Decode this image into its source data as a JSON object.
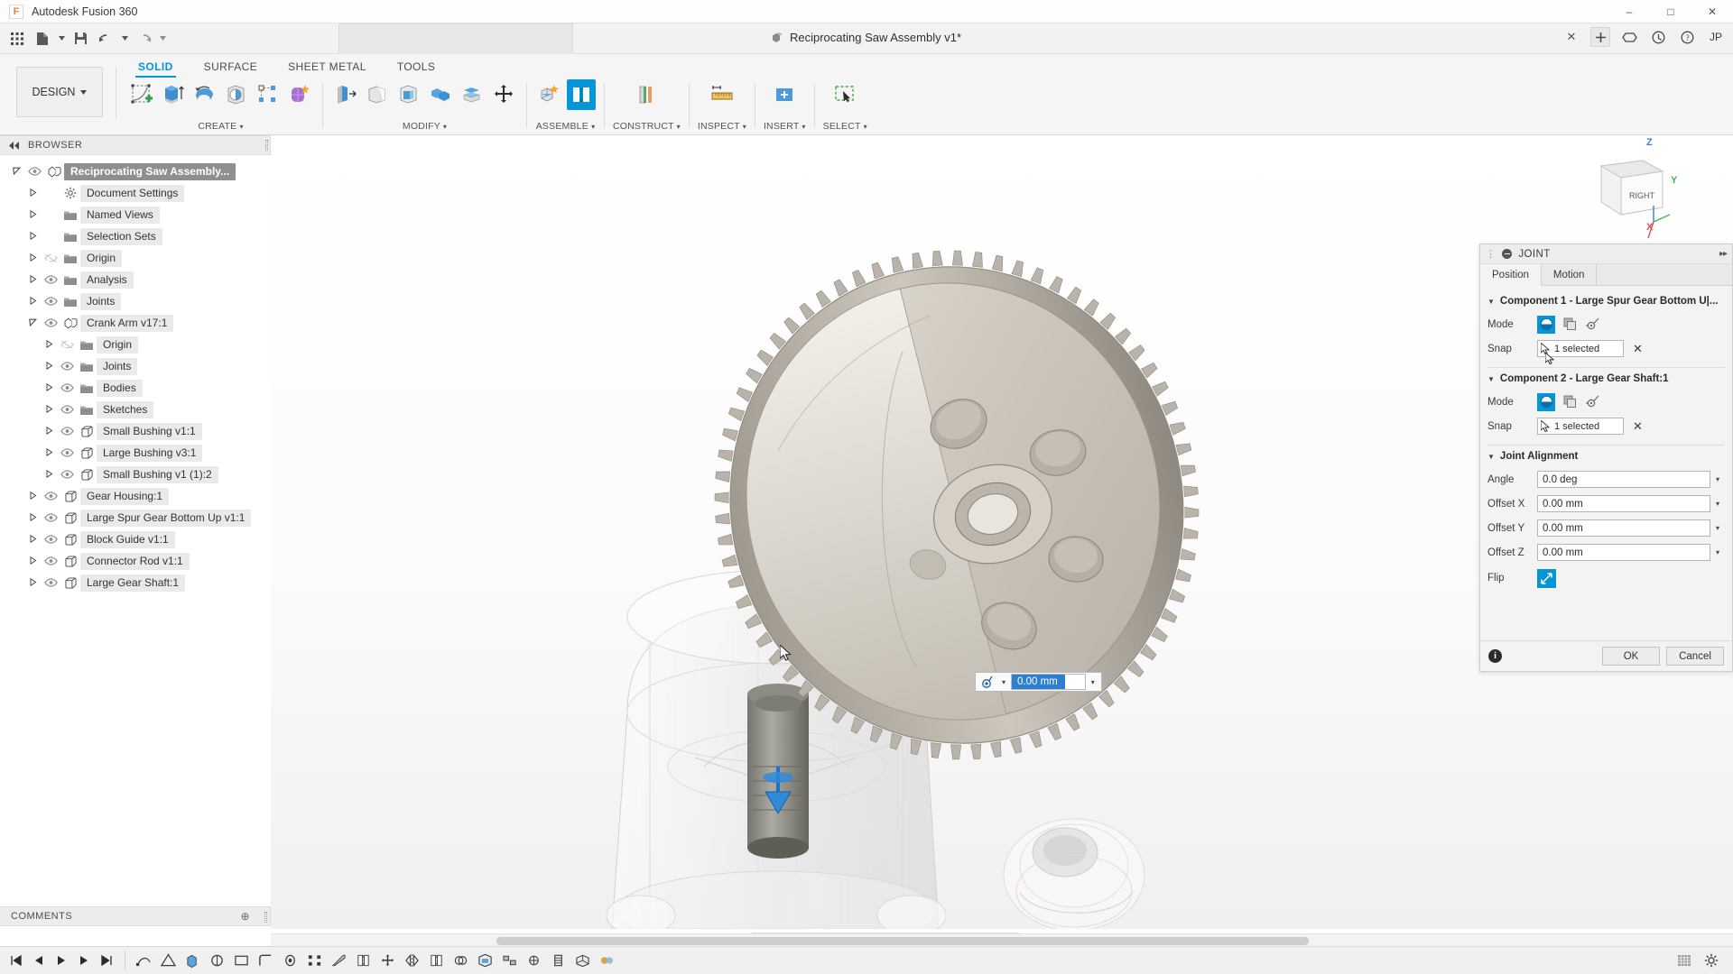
{
  "titlebar": {
    "app_name": "Autodesk Fusion 360",
    "logo_glyph": "F",
    "minimize": "–",
    "maximize": "□",
    "close": "✕"
  },
  "quick_access": {
    "grid_icon": "grid-icon",
    "new_icon": "new-document-icon",
    "save_icon": "save-icon",
    "undo_icon": "undo-icon",
    "redo_icon": "redo-icon",
    "document_title": "Reciprocating Saw Assembly v1*",
    "close_doc": "✕",
    "user_initials": "JP"
  },
  "ribbon": {
    "workspace": "DESIGN",
    "tabs": [
      {
        "label": "SOLID",
        "active": true
      },
      {
        "label": "SURFACE",
        "active": false
      },
      {
        "label": "SHEET METAL",
        "active": false
      },
      {
        "label": "TOOLS",
        "active": false
      }
    ],
    "groups": [
      {
        "label": "CREATE",
        "icons": [
          "create-sketch-icon",
          "extrude-icon",
          "revolve-icon",
          "sphere-icon",
          "pattern-icon",
          "form-icon"
        ]
      },
      {
        "label": "MODIFY",
        "icons": [
          "press-pull-icon",
          "fillet-icon",
          "shell-icon",
          "combine-icon",
          "offset-face-icon",
          "move-copy-icon"
        ]
      },
      {
        "label": "ASSEMBLE",
        "icons": [
          "new-component-icon",
          "joint-icon"
        ]
      },
      {
        "label": "CONSTRUCT",
        "icons": [
          "offset-plane-icon"
        ]
      },
      {
        "label": "INSPECT",
        "icons": [
          "measure-icon"
        ]
      },
      {
        "label": "INSERT",
        "icons": [
          "insert-derive-icon"
        ]
      },
      {
        "label": "SELECT",
        "icons": [
          "select-window-icon"
        ]
      }
    ]
  },
  "browser": {
    "header": "BROWSER",
    "collapse_icon": "collapse-left-icon",
    "items": [
      {
        "label": "Reciprocating Saw Assembly...",
        "depth": 0,
        "arrow": "open",
        "eye": "on",
        "icon": "assembly-icon",
        "root": true,
        "dot": true
      },
      {
        "label": "Document Settings",
        "depth": 1,
        "arrow": "closed",
        "eye": "none",
        "icon": "gear-icon"
      },
      {
        "label": "Named Views",
        "depth": 1,
        "arrow": "closed",
        "eye": "none",
        "icon": "folder-icon"
      },
      {
        "label": "Selection Sets",
        "depth": 1,
        "arrow": "closed",
        "eye": "none",
        "icon": "folder-icon"
      },
      {
        "label": "Origin",
        "depth": 1,
        "arrow": "closed",
        "eye": "off",
        "icon": "folder-icon"
      },
      {
        "label": "Analysis",
        "depth": 1,
        "arrow": "closed",
        "eye": "on",
        "icon": "folder-icon"
      },
      {
        "label": "Joints",
        "depth": 1,
        "arrow": "closed",
        "eye": "on",
        "icon": "folder-icon"
      },
      {
        "label": "Crank Arm v17:1",
        "depth": 1,
        "arrow": "open",
        "eye": "on",
        "icon": "component-icon"
      },
      {
        "label": "Origin",
        "depth": 2,
        "arrow": "closed",
        "eye": "off",
        "icon": "folder-icon"
      },
      {
        "label": "Joints",
        "depth": 2,
        "arrow": "closed",
        "eye": "on",
        "icon": "folder-icon"
      },
      {
        "label": "Bodies",
        "depth": 2,
        "arrow": "closed",
        "eye": "on",
        "icon": "folder-icon"
      },
      {
        "label": "Sketches",
        "depth": 2,
        "arrow": "closed",
        "eye": "on",
        "icon": "folder-icon"
      },
      {
        "label": "Small Bushing v1:1",
        "depth": 2,
        "arrow": "closed",
        "eye": "on",
        "icon": "body-icon"
      },
      {
        "label": "Large Bushing v3:1",
        "depth": 2,
        "arrow": "closed",
        "eye": "on",
        "icon": "body-icon"
      },
      {
        "label": "Small Bushing v1 (1):2",
        "depth": 2,
        "arrow": "closed",
        "eye": "on",
        "icon": "body-icon"
      },
      {
        "label": "Gear Housing:1",
        "depth": 1,
        "arrow": "closed",
        "eye": "on",
        "icon": "body-icon"
      },
      {
        "label": "Large Spur Gear Bottom Up v1:1",
        "depth": 1,
        "arrow": "closed",
        "eye": "on",
        "icon": "body-icon"
      },
      {
        "label": "Block Guide v1:1",
        "depth": 1,
        "arrow": "closed",
        "eye": "on",
        "icon": "body-icon"
      },
      {
        "label": "Connector Rod v1:1",
        "depth": 1,
        "arrow": "closed",
        "eye": "on",
        "icon": "body-icon"
      },
      {
        "label": "Large Gear Shaft:1",
        "depth": 1,
        "arrow": "closed",
        "eye": "on",
        "icon": "body-icon"
      }
    ]
  },
  "comments": {
    "label": "COMMENTS",
    "expand_icon": "expand-icon"
  },
  "viewcube": {
    "face_label": "RIGHT",
    "axis_z": "Z",
    "axis_y": "Y",
    "axis_x": "X"
  },
  "manipulator": {
    "value": "0.00 mm",
    "joint_origin_icon": "joint-origin-icon",
    "caret": "▾"
  },
  "navbar": {
    "buttons": [
      "orbit-icon",
      "caret-down-icon",
      "look-at-icon",
      "pan-icon",
      "zoom-icon",
      "zoom-window-icon",
      "caret-down-icon",
      "display-settings-icon",
      "caret-down-icon",
      "grid-snaps-icon",
      "caret-down-icon",
      "viewports-icon",
      "caret-down-icon"
    ]
  },
  "joint_dialog": {
    "title": "JOINT",
    "collapse_icon": "minimize-icon",
    "expand_icon": "expand-right-icon",
    "tabs": [
      {
        "label": "Position",
        "active": true
      },
      {
        "label": "Motion",
        "active": false
      }
    ],
    "component1": {
      "header": "Component 1 - Large Spur Gear Bottom U|...",
      "mode_label": "Mode",
      "mode_icons": [
        "planar-joint-icon",
        "copy-mode-icon",
        "between-two-faces-icon"
      ],
      "mode_selected_index": 0,
      "snap_label": "Snap",
      "snap_value": "1 selected",
      "snap_icon": "cursor-select-icon",
      "clear_icon": "✕"
    },
    "component2": {
      "header": "Component 2 - Large Gear Shaft:1",
      "mode_label": "Mode",
      "mode_icons": [
        "planar-joint-icon",
        "copy-mode-icon",
        "between-two-faces-icon"
      ],
      "mode_selected_index": 0,
      "snap_label": "Snap",
      "snap_value": "1 selected",
      "snap_icon": "cursor-select-icon",
      "clear_icon": "✕"
    },
    "alignment": {
      "header": "Joint Alignment",
      "fields": [
        {
          "label": "Angle",
          "value": "0.0 deg"
        },
        {
          "label": "Offset X",
          "value": "0.00 mm"
        },
        {
          "label": "Offset Y",
          "value": "0.00 mm"
        },
        {
          "label": "Offset Z",
          "value": "0.00 mm"
        }
      ],
      "flip_label": "Flip",
      "flip_icon": "flip-icon"
    },
    "footer": {
      "info_icon": "i",
      "ok_label": "OK",
      "cancel_label": "Cancel"
    }
  },
  "timeline": {
    "playback": [
      "jump-start-icon",
      "step-back-icon",
      "play-icon",
      "step-forward-icon",
      "jump-end-icon"
    ],
    "nodes": [
      "sketch-icon",
      "construct-plane-icon",
      "extrude-icon",
      "revolve-icon",
      "sketch2-icon",
      "fillet-icon",
      "hole-icon",
      "pattern-icon",
      "chamfer-icon",
      "joint-icon-1",
      "move-icon",
      "mirror-icon",
      "joint-icon-2",
      "combine-icon",
      "shell-icon",
      "rigid-group-icon",
      "as-built-joint-icon",
      "thread-icon",
      "component-icon",
      "appearance-icon"
    ],
    "right": [
      "grid-toggle-icon",
      "settings-gear-icon"
    ]
  },
  "colors": {
    "accent": "#0696d7",
    "selection_blue": "#2f7fd1",
    "axis_z": "#2f7fd1",
    "axis_y": "#4caf50",
    "axis_x": "#e05050",
    "ribbon_bg": "#f5f5f5",
    "panel_bg": "#f3f3f3"
  }
}
